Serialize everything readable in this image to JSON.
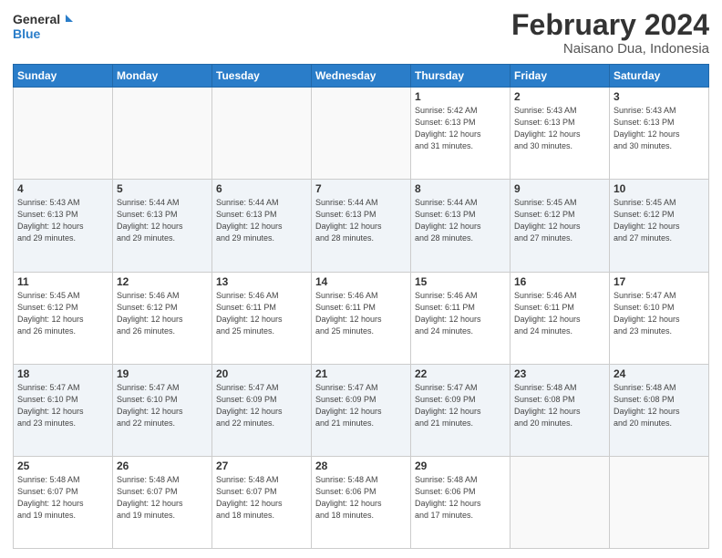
{
  "header": {
    "logo_line1": "General",
    "logo_line2": "Blue",
    "month": "February 2024",
    "location": "Naisano Dua, Indonesia"
  },
  "weekdays": [
    "Sunday",
    "Monday",
    "Tuesday",
    "Wednesday",
    "Thursday",
    "Friday",
    "Saturday"
  ],
  "weeks": [
    [
      {
        "day": "",
        "info": ""
      },
      {
        "day": "",
        "info": ""
      },
      {
        "day": "",
        "info": ""
      },
      {
        "day": "",
        "info": ""
      },
      {
        "day": "1",
        "info": "Sunrise: 5:42 AM\nSunset: 6:13 PM\nDaylight: 12 hours\nand 31 minutes."
      },
      {
        "day": "2",
        "info": "Sunrise: 5:43 AM\nSunset: 6:13 PM\nDaylight: 12 hours\nand 30 minutes."
      },
      {
        "day": "3",
        "info": "Sunrise: 5:43 AM\nSunset: 6:13 PM\nDaylight: 12 hours\nand 30 minutes."
      }
    ],
    [
      {
        "day": "4",
        "info": "Sunrise: 5:43 AM\nSunset: 6:13 PM\nDaylight: 12 hours\nand 29 minutes."
      },
      {
        "day": "5",
        "info": "Sunrise: 5:44 AM\nSunset: 6:13 PM\nDaylight: 12 hours\nand 29 minutes."
      },
      {
        "day": "6",
        "info": "Sunrise: 5:44 AM\nSunset: 6:13 PM\nDaylight: 12 hours\nand 29 minutes."
      },
      {
        "day": "7",
        "info": "Sunrise: 5:44 AM\nSunset: 6:13 PM\nDaylight: 12 hours\nand 28 minutes."
      },
      {
        "day": "8",
        "info": "Sunrise: 5:44 AM\nSunset: 6:13 PM\nDaylight: 12 hours\nand 28 minutes."
      },
      {
        "day": "9",
        "info": "Sunrise: 5:45 AM\nSunset: 6:12 PM\nDaylight: 12 hours\nand 27 minutes."
      },
      {
        "day": "10",
        "info": "Sunrise: 5:45 AM\nSunset: 6:12 PM\nDaylight: 12 hours\nand 27 minutes."
      }
    ],
    [
      {
        "day": "11",
        "info": "Sunrise: 5:45 AM\nSunset: 6:12 PM\nDaylight: 12 hours\nand 26 minutes."
      },
      {
        "day": "12",
        "info": "Sunrise: 5:46 AM\nSunset: 6:12 PM\nDaylight: 12 hours\nand 26 minutes."
      },
      {
        "day": "13",
        "info": "Sunrise: 5:46 AM\nSunset: 6:11 PM\nDaylight: 12 hours\nand 25 minutes."
      },
      {
        "day": "14",
        "info": "Sunrise: 5:46 AM\nSunset: 6:11 PM\nDaylight: 12 hours\nand 25 minutes."
      },
      {
        "day": "15",
        "info": "Sunrise: 5:46 AM\nSunset: 6:11 PM\nDaylight: 12 hours\nand 24 minutes."
      },
      {
        "day": "16",
        "info": "Sunrise: 5:46 AM\nSunset: 6:11 PM\nDaylight: 12 hours\nand 24 minutes."
      },
      {
        "day": "17",
        "info": "Sunrise: 5:47 AM\nSunset: 6:10 PM\nDaylight: 12 hours\nand 23 minutes."
      }
    ],
    [
      {
        "day": "18",
        "info": "Sunrise: 5:47 AM\nSunset: 6:10 PM\nDaylight: 12 hours\nand 23 minutes."
      },
      {
        "day": "19",
        "info": "Sunrise: 5:47 AM\nSunset: 6:10 PM\nDaylight: 12 hours\nand 22 minutes."
      },
      {
        "day": "20",
        "info": "Sunrise: 5:47 AM\nSunset: 6:09 PM\nDaylight: 12 hours\nand 22 minutes."
      },
      {
        "day": "21",
        "info": "Sunrise: 5:47 AM\nSunset: 6:09 PM\nDaylight: 12 hours\nand 21 minutes."
      },
      {
        "day": "22",
        "info": "Sunrise: 5:47 AM\nSunset: 6:09 PM\nDaylight: 12 hours\nand 21 minutes."
      },
      {
        "day": "23",
        "info": "Sunrise: 5:48 AM\nSunset: 6:08 PM\nDaylight: 12 hours\nand 20 minutes."
      },
      {
        "day": "24",
        "info": "Sunrise: 5:48 AM\nSunset: 6:08 PM\nDaylight: 12 hours\nand 20 minutes."
      }
    ],
    [
      {
        "day": "25",
        "info": "Sunrise: 5:48 AM\nSunset: 6:07 PM\nDaylight: 12 hours\nand 19 minutes."
      },
      {
        "day": "26",
        "info": "Sunrise: 5:48 AM\nSunset: 6:07 PM\nDaylight: 12 hours\nand 19 minutes."
      },
      {
        "day": "27",
        "info": "Sunrise: 5:48 AM\nSunset: 6:07 PM\nDaylight: 12 hours\nand 18 minutes."
      },
      {
        "day": "28",
        "info": "Sunrise: 5:48 AM\nSunset: 6:06 PM\nDaylight: 12 hours\nand 18 minutes."
      },
      {
        "day": "29",
        "info": "Sunrise: 5:48 AM\nSunset: 6:06 PM\nDaylight: 12 hours\nand 17 minutes."
      },
      {
        "day": "",
        "info": ""
      },
      {
        "day": "",
        "info": ""
      }
    ]
  ]
}
